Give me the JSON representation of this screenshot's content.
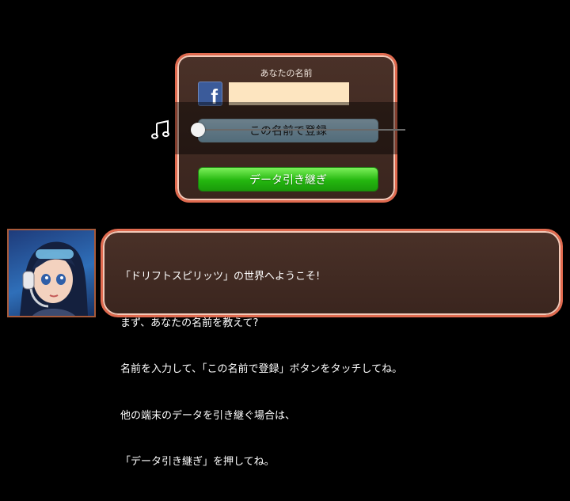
{
  "dialog": {
    "title": "あなたの名前",
    "name_value": "",
    "facebook_icon": "f",
    "register_label": "この名前で登録",
    "transfer_label": "データ引き継ぎ"
  },
  "volume": {
    "icon": "music-note-icon",
    "level": 0.0
  },
  "message": {
    "lines": [
      "「ドリフトスピリッツ」の世界へようこそ!",
      "まず、あなたの名前を教えて?",
      "名前を入力して、「この名前で登録」ボタンをタッチしてね。",
      "他の端末のデータを引き継ぐ場合は、",
      "「データ引き継ぎ」を押してね。"
    ]
  },
  "colors": {
    "frame_border": "#e06a4f",
    "panel_bg": "#3f2a22",
    "register_button": "#a6cde4",
    "transfer_button": "#2cc419",
    "input_bg": "#fde5c0"
  }
}
